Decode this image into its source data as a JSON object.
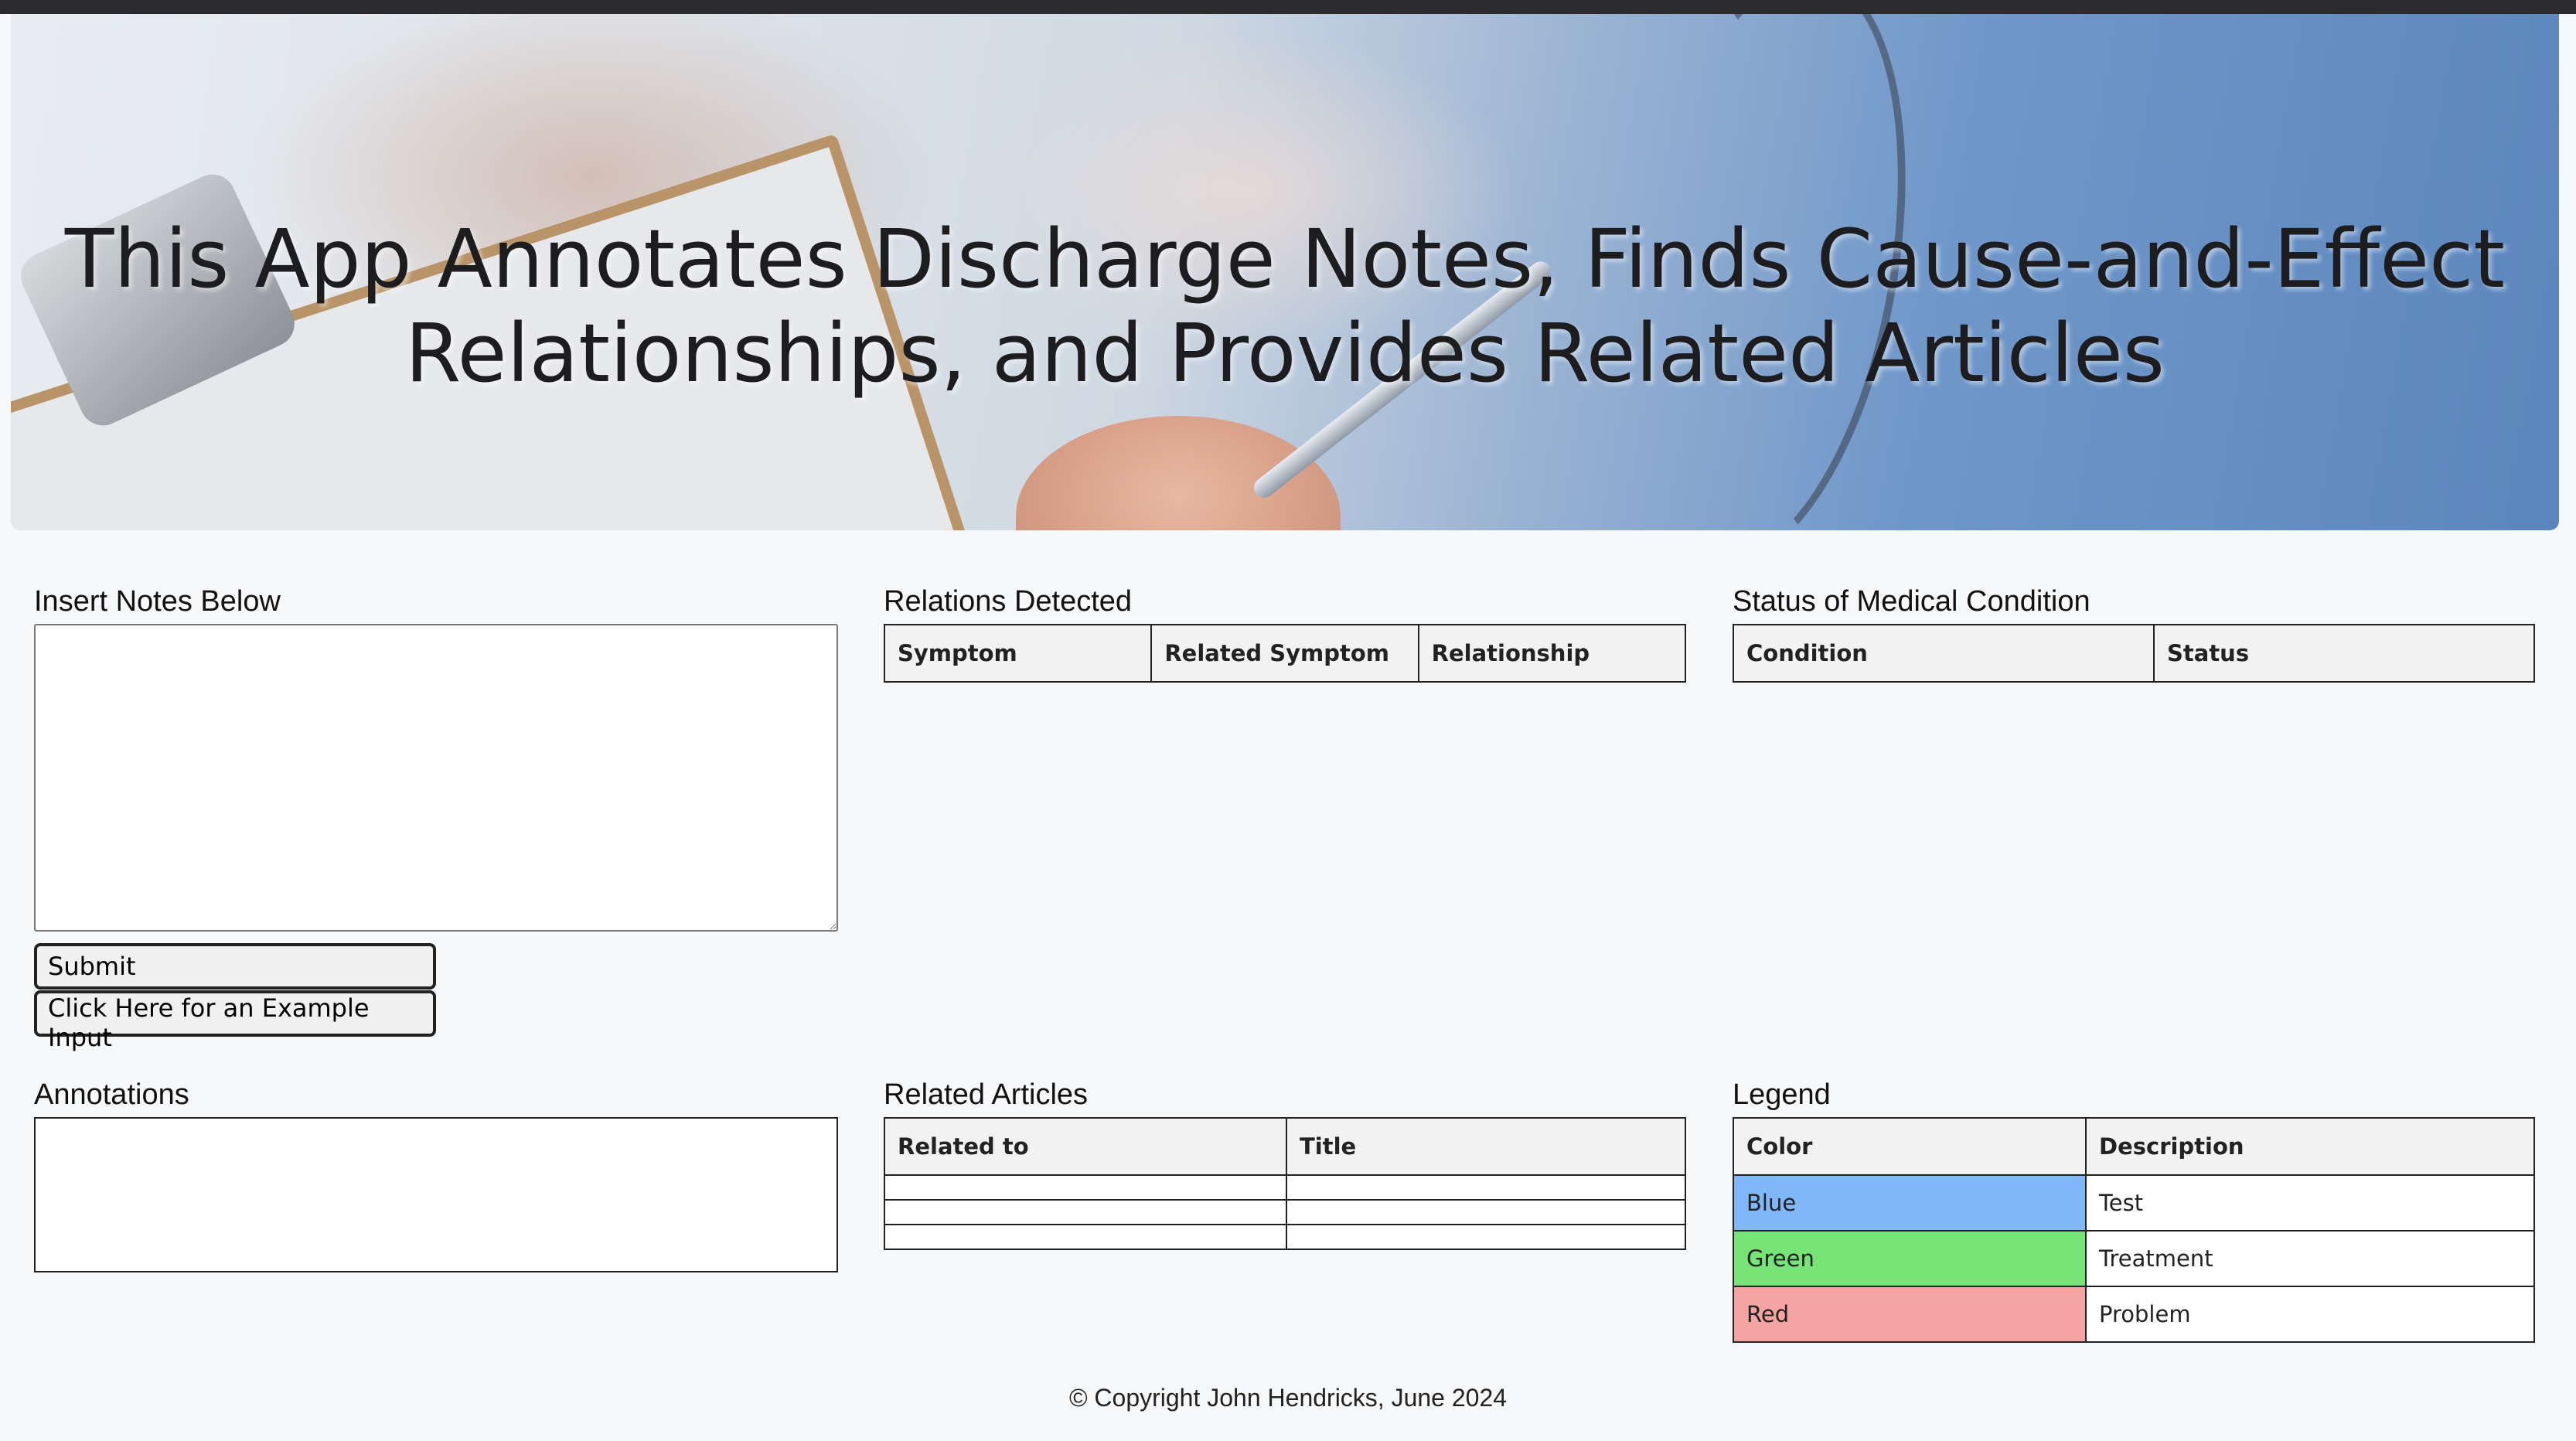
{
  "hero": {
    "title": "This App Annotates Discharge Notes, Finds Cause-and-Effect Relationships, and Provides Related Articles"
  },
  "notes": {
    "title": "Insert Notes Below",
    "value": "",
    "submit_label": "Submit",
    "example_label": "Click Here for an Example Input"
  },
  "relations": {
    "title": "Relations Detected",
    "columns": [
      "Symptom",
      "Related Symptom",
      "Relationship"
    ]
  },
  "status": {
    "title": "Status of Medical Condition",
    "columns": [
      "Condition",
      "Status"
    ]
  },
  "annotations": {
    "title": "Annotations"
  },
  "articles": {
    "title": "Related Articles",
    "columns": [
      "Related to",
      "Title"
    ]
  },
  "legend": {
    "title": "Legend",
    "columns": [
      "Color",
      "Description"
    ],
    "rows": [
      {
        "color": "Blue",
        "description": "Test",
        "swatch": "#80b7f8"
      },
      {
        "color": "Green",
        "description": "Treatment",
        "swatch": "#76e477"
      },
      {
        "color": "Red",
        "description": "Problem",
        "swatch": "#f5a3a3"
      }
    ]
  },
  "footer": {
    "text": "© Copyright John Hendricks, June 2024"
  }
}
